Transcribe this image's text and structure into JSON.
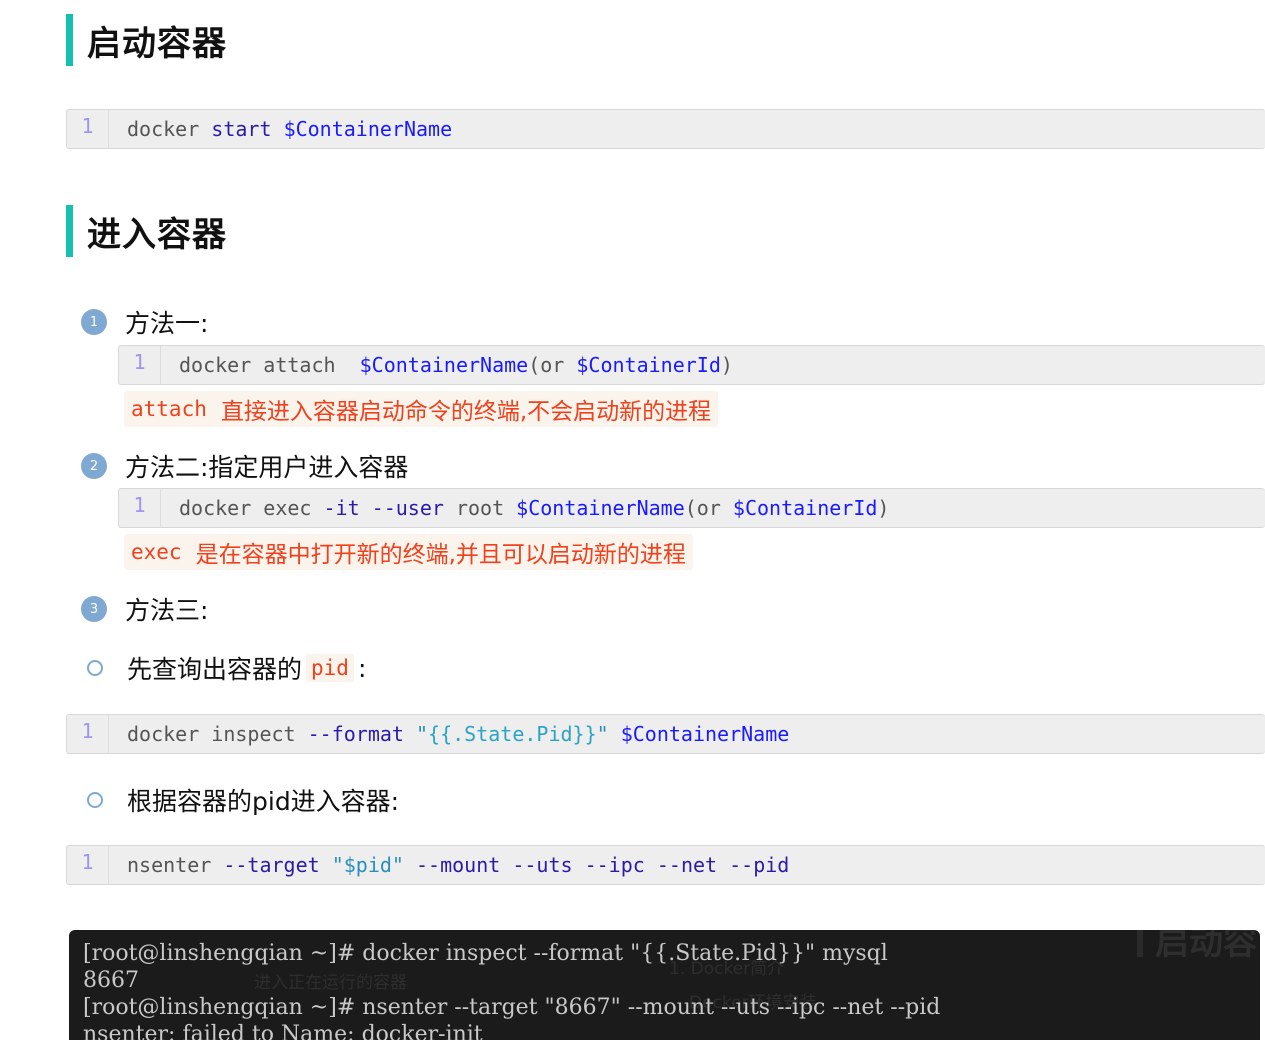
{
  "sections": [
    {
      "title": "启动容器"
    },
    {
      "title": "进入容器"
    }
  ],
  "code_blocks": {
    "start": {
      "line_no": "1",
      "tokens": {
        "a": "docker ",
        "b": "start",
        "c": " ",
        "d": "$ContainerName"
      }
    },
    "attach": {
      "line_no": "1",
      "tokens": {
        "a": "docker attach  ",
        "b": "$ContainerName",
        "c": "(or ",
        "d": "$ContainerId",
        "e": ")"
      }
    },
    "exec": {
      "line_no": "1",
      "tokens": {
        "a": "docker exec ",
        "b": "-it",
        "c": " ",
        "d": "--user",
        "e": " root ",
        "f": "$ContainerName",
        "g": "(or ",
        "h": "$ContainerId",
        "i": ")"
      }
    },
    "inspect": {
      "line_no": "1",
      "tokens": {
        "a": "docker inspect ",
        "b": "--format",
        "c": " \"",
        "d": "{{.State.Pid}}",
        "e": "\" ",
        "f": "$ContainerName"
      }
    },
    "nsenter": {
      "line_no": "1",
      "tokens": {
        "a": "nsenter ",
        "b": "--target",
        "c": " \"$pid\" ",
        "d": "--mount",
        "e": " ",
        "f": "--uts",
        "g": " ",
        "h": "--ipc",
        "i": " ",
        "j": "--net",
        "k": " ",
        "l": "--pid"
      }
    }
  },
  "list": {
    "method1": {
      "num": "1",
      "label": "方法一:"
    },
    "method2": {
      "num": "2",
      "label": "方法二:指定用户进入容器"
    },
    "method3": {
      "num": "3",
      "label": "方法三:"
    },
    "sub1": {
      "label": "先查询出容器的",
      "code": "pid",
      "suffix": ":"
    },
    "sub2": {
      "label": "根据容器的pid进入容器:"
    }
  },
  "notes": {
    "attach": {
      "code": "attach",
      "text": "直接进入容器启动命令的终端,不会启动新的进程"
    },
    "exec": {
      "code": "exec",
      "text": "是在容器中打开新的终端,并且可以启动新的进程"
    }
  },
  "terminal": {
    "lines": [
      "[root@linshengqian ~]# docker inspect --format \"{{.State.Pid}}\" mysql",
      "8667",
      "[root@linshengqian ~]# nsenter --target \"8667\" --mount --uts --ipc --net --pid",
      "nsenter: failed to Name: docker-init"
    ],
    "ghost_texts": [
      "进入正在运行的容器",
      "1. Docker简介",
      "Docker环境安装",
      "启动容"
    ]
  }
}
